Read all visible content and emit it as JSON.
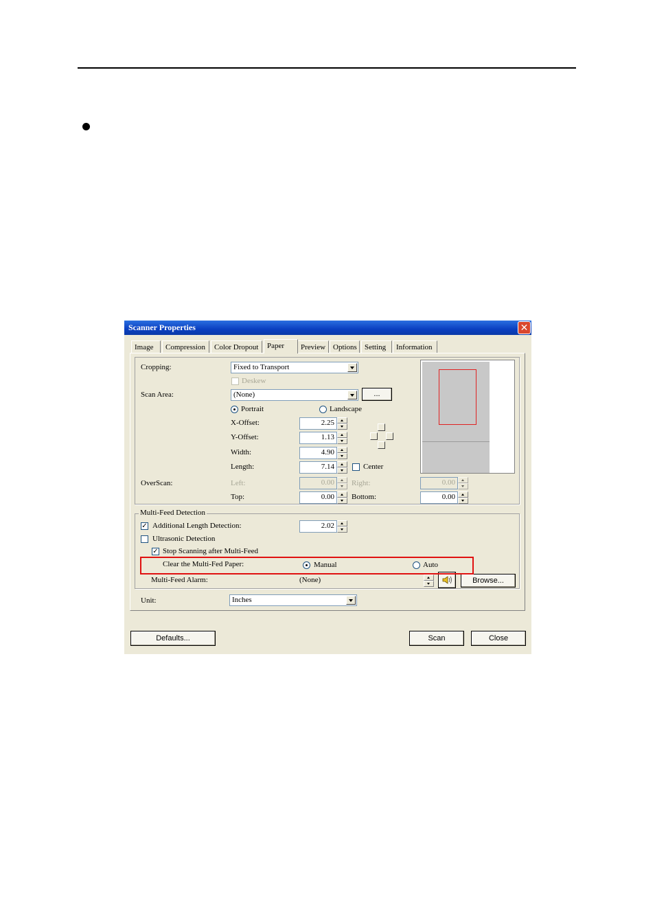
{
  "window": {
    "title": "Scanner Properties",
    "close_glyph": "✕"
  },
  "tabs": [
    "Image",
    "Compression",
    "Color Dropout",
    "Paper",
    "Preview",
    "Options",
    "Setting",
    "Information"
  ],
  "active_tab": "Paper",
  "paper": {
    "cropping_label": "Cropping:",
    "cropping_value": "Fixed to Transport",
    "deskew_label": "Deskew",
    "scan_area_label": "Scan Area:",
    "scan_area_value": "(None)",
    "more_button": "...",
    "portrait_label": "Portrait",
    "landscape_label": "Landscape",
    "orientation": "Portrait",
    "xoffset_label": "X-Offset:",
    "xoffset_value": "2.25",
    "yoffset_label": "Y-Offset:",
    "yoffset_value": "1.13",
    "width_label": "Width:",
    "width_value": "4.90",
    "length_label": "Length:",
    "length_value": "7.14",
    "center_label": "Center",
    "overscan_label": "OverScan:",
    "left_label": "Left:",
    "left_value": "0.00",
    "right_label": "Right:",
    "right_value": "0.00",
    "top_label": "Top:",
    "top_value": "0.00",
    "bottom_label": "Bottom:",
    "bottom_value": "0.00"
  },
  "multifeed": {
    "group_title": "Multi-Feed Detection",
    "length_detection_label": "Additional Length Detection:",
    "length_detection_value": "2.02",
    "length_detection_checked": true,
    "ultrasonic_label": "Ultrasonic Detection",
    "ultrasonic_checked": false,
    "stop_label": "Stop Scanning after Multi-Feed",
    "stop_checked": true,
    "clear_label": "Clear the Multi-Fed Paper:",
    "manual_label": "Manual",
    "auto_label": "Auto",
    "clear_mode": "Manual",
    "alarm_label": "Multi-Feed Alarm:",
    "alarm_value": "(None)",
    "browse_button": "Browse..."
  },
  "unit": {
    "label": "Unit:",
    "value": "Inches"
  },
  "buttons": {
    "defaults": "Defaults...",
    "scan": "Scan",
    "close": "Close"
  },
  "check_glyph": "✓",
  "colors": {
    "title_bar": "#0a3fc0",
    "highlight_box": "#e01010",
    "crop_box": "#e02020"
  }
}
